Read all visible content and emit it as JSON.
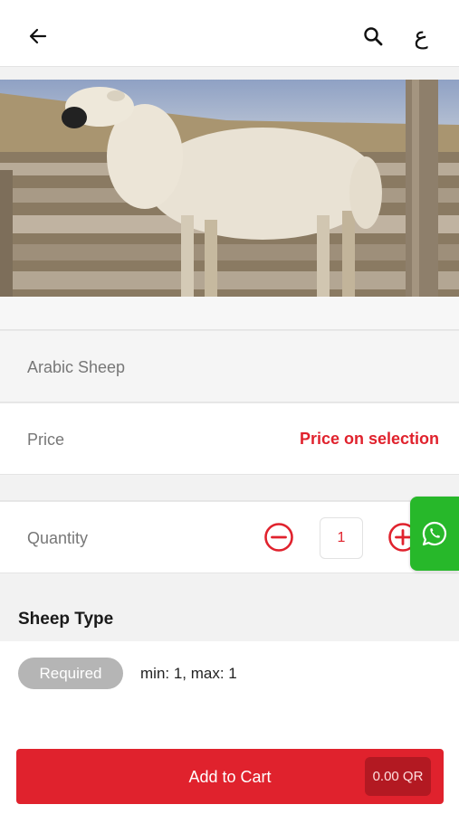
{
  "header": {
    "back_icon": "arrow-left-icon",
    "search_icon": "search-icon",
    "language_toggle": "ع"
  },
  "hero": {
    "image": "sheep-photo"
  },
  "product": {
    "name": "Arabic Sheep",
    "price_label": "Price",
    "price_value": "Price on selection"
  },
  "quantity": {
    "label": "Quantity",
    "value": "1",
    "minus_icon": "minus-circle-icon",
    "plus_icon": "plus-circle-icon"
  },
  "whatsapp": {
    "icon": "whatsapp-icon",
    "color": "#27b82a"
  },
  "options": {
    "title": "Sheep Type",
    "required_label": "Required",
    "constraint": "min: 1, max: 1"
  },
  "cart": {
    "label": "Add to Cart",
    "total": "0.00 QR"
  },
  "colors": {
    "accent": "#e0222d",
    "whatsapp": "#27b82a"
  }
}
